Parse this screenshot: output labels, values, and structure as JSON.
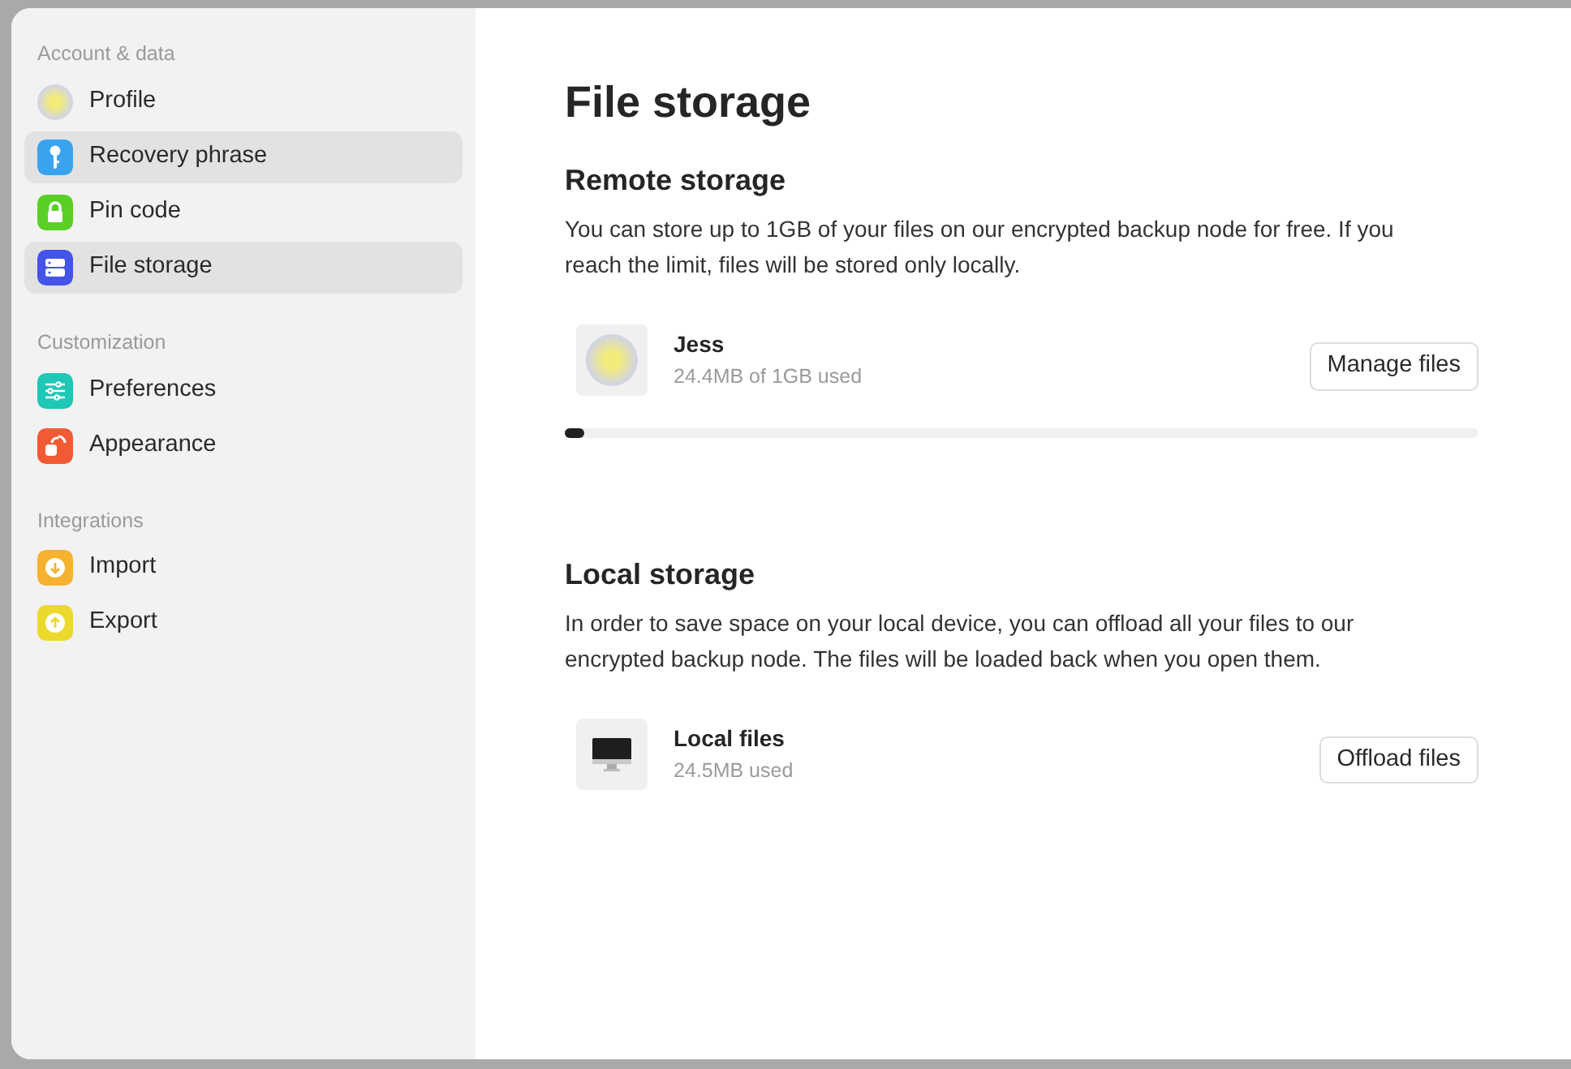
{
  "sidebar": {
    "groups": [
      {
        "title": "Account & data",
        "items": [
          {
            "label": "Profile",
            "kind": "avatar",
            "selected": false
          },
          {
            "label": "Recovery phrase",
            "kind": "key",
            "color": "#3aa3f0",
            "selected": true
          },
          {
            "label": "Pin code",
            "kind": "lock",
            "color": "#5ad026",
            "selected": false
          },
          {
            "label": "File storage",
            "kind": "storage",
            "color": "#4453e8",
            "selected": true
          }
        ]
      },
      {
        "title": "Customization",
        "items": [
          {
            "label": "Preferences",
            "kind": "sliders",
            "color": "#1ec7b6",
            "selected": false
          },
          {
            "label": "Appearance",
            "kind": "layers",
            "color": "#f25a33",
            "selected": false
          }
        ]
      },
      {
        "title": "Integrations",
        "items": [
          {
            "label": "Import",
            "kind": "download",
            "color": "#f6b12f",
            "selected": false
          },
          {
            "label": "Export",
            "kind": "upload",
            "color": "#ecd92e",
            "selected": false
          }
        ]
      }
    ]
  },
  "page": {
    "title": "File storage",
    "sections": [
      {
        "title": "Remote storage",
        "text": "You can store up to 1GB of your files on our encrypted backup node for free. If you reach the limit, files will be stored only locally.",
        "entry": {
          "kind": "avatar",
          "name": "Jess",
          "usage": "24.4MB of 1GB used",
          "button": "Manage files"
        },
        "level": 0.02
      },
      {
        "title": "Local storage",
        "text": "In order to save space on your local device, you can offload all your files to our encrypted backup node. The files will be loaded back when you open them.",
        "entry": {
          "kind": "monitor",
          "name": "Local files",
          "usage": "24.5MB used",
          "button": "Offload files"
        }
      }
    ]
  }
}
